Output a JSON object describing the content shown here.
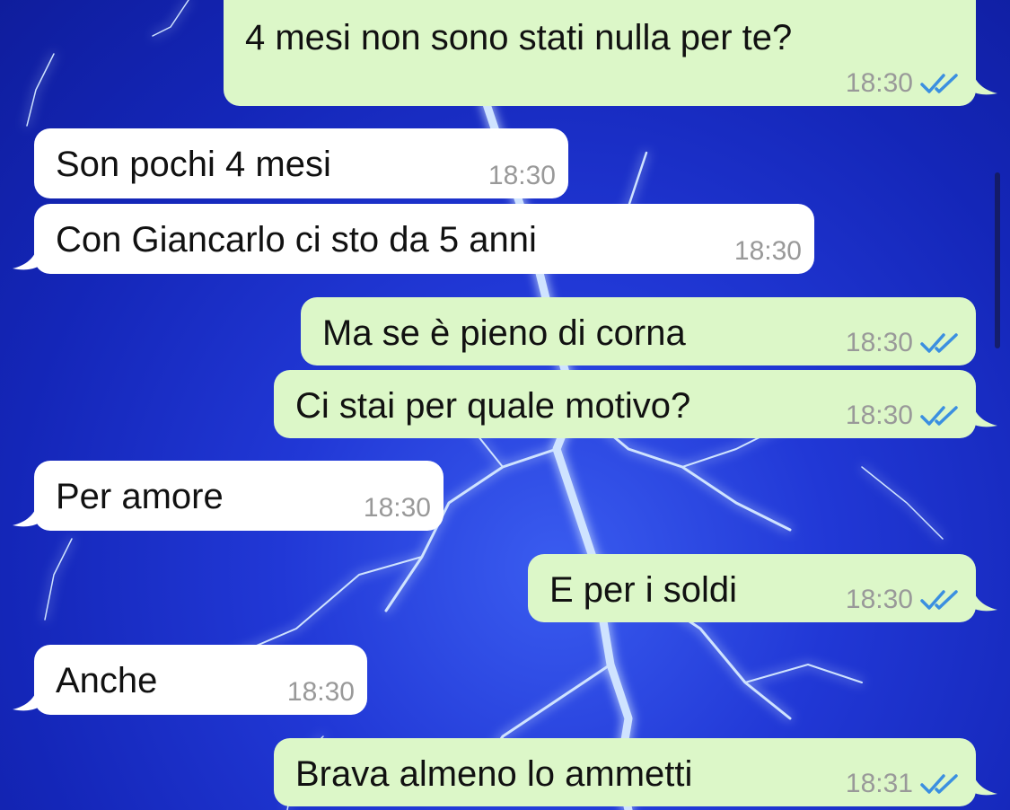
{
  "messages": [
    {
      "direction": "out",
      "text": "4 mesi non sono stati nulla per te?",
      "time": "18:30",
      "status": "read"
    },
    {
      "direction": "in",
      "text": "Son pochi 4 mesi",
      "time": "18:30"
    },
    {
      "direction": "in",
      "text": "Con Giancarlo ci sto da 5 anni",
      "time": "18:30"
    },
    {
      "direction": "out",
      "text": "Ma se è pieno di corna",
      "time": "18:30",
      "status": "read"
    },
    {
      "direction": "out",
      "text": "Ci stai per quale motivo?",
      "time": "18:30",
      "status": "read"
    },
    {
      "direction": "in",
      "text": "Per amore",
      "time": "18:30"
    },
    {
      "direction": "out",
      "text": "E per i soldi",
      "time": "18:30",
      "status": "read"
    },
    {
      "direction": "in",
      "text": "Anche",
      "time": "18:30"
    },
    {
      "direction": "out",
      "text": "Brava almeno lo ammetti",
      "time": "18:31",
      "status": "read"
    }
  ],
  "colors": {
    "outgoing_bubble": "#dcf7c8",
    "incoming_bubble": "#ffffff",
    "read_ticks": "#3b8fe0",
    "timestamp": "#999999"
  },
  "wallpaper": "lightning-storm"
}
